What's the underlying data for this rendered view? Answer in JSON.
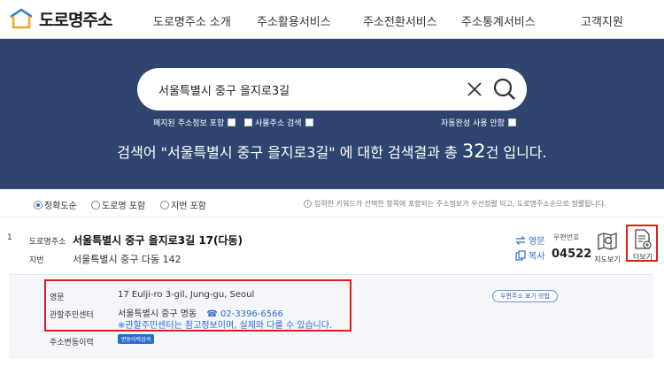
{
  "header": {
    "logo_text": "도로명주소",
    "nav": [
      "도로명주소 소개",
      "주소활용서비스",
      "주소전환서비스",
      "주소통계서비스",
      "고객지원"
    ]
  },
  "search": {
    "value": "서울특별시 중구 을지로3길",
    "options": [
      "폐지된 주소정보 포함",
      "사물주소 검색",
      "자동완성 사용 안함"
    ]
  },
  "summary": {
    "prefix": "검색어 ",
    "query_quoted": "\"서울특별시 중구 을지로3길\"",
    "middle": " 에 대한 검색결과 총 ",
    "count": "32",
    "suffix": "건 입니다."
  },
  "filter": {
    "radios": [
      "정확도순",
      "도로명 포함",
      "지번 포함"
    ],
    "selected": "정확도순",
    "note": "입력한 키워드가 선택한 항목에 포함되는 주소정보가 우선정렬 되고, 도로명주소순으로 정렬됩니다."
  },
  "result": {
    "number": "1",
    "road_label": "도로명주소",
    "road_address": "서울특별시 중구 을지로3길 17(다동)",
    "jibun_label": "지번",
    "jibun_address": "서울특별시 중구 다동 142",
    "english_action": "영문",
    "copy_action": "복사",
    "zip_label": "우편번호",
    "zip_code": "04522",
    "map_label": "지도보기",
    "more_label": "더보기"
  },
  "detail": {
    "english_label": "영문",
    "english_value": "17 Eulji-ro 3-gil, Jung-gu, Seoul",
    "english_button": "우편주소 표기 방법",
    "center_label": "관할주민센터",
    "center_name": "서울특별시 중구 명동",
    "center_phone": "02-3396-6566",
    "center_note": "※관할주민센터는 참고정보이며, 실제와 다를 수 있습니다.",
    "history_label": "주소변동이력",
    "history_button": "변동이력검색"
  },
  "colors": {
    "hero_bg": "#2f4570",
    "accent_blue": "#2d6bd0",
    "highlight_red": "#e21b1b",
    "detail_bg": "#f4f6f9"
  }
}
